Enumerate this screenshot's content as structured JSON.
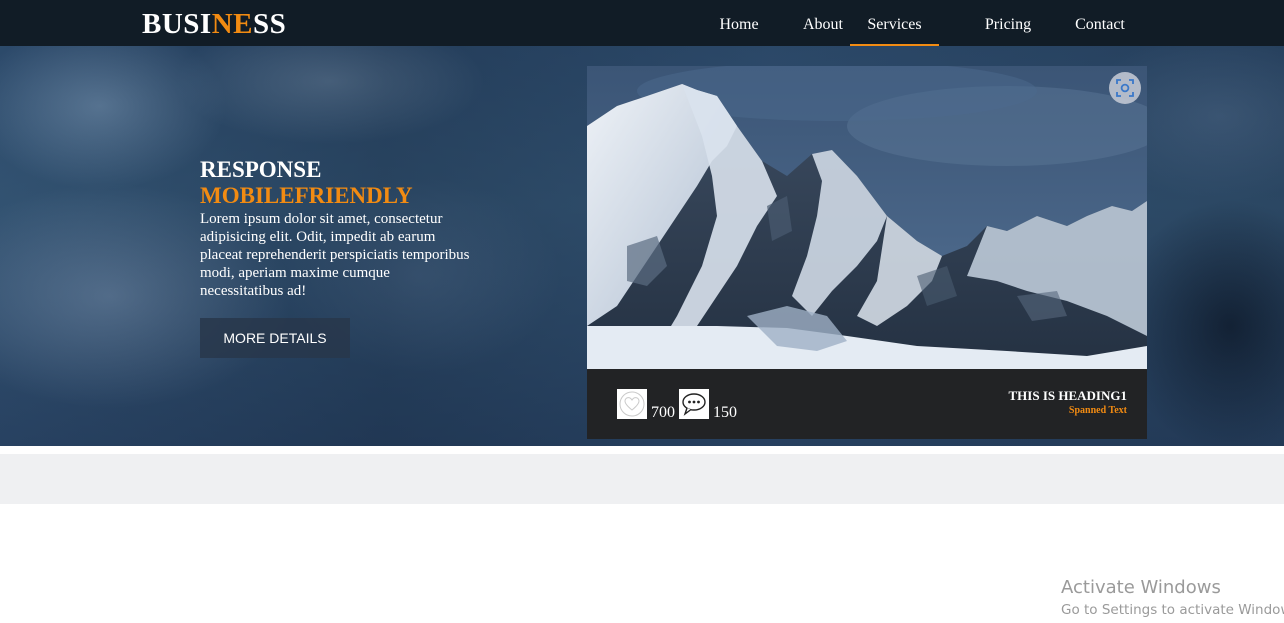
{
  "brand": {
    "prefix": "BUSI",
    "accent": "NE",
    "suffix": "SS",
    "accent_color": "#f28b12"
  },
  "nav": {
    "items": [
      {
        "label": "Home"
      },
      {
        "label": "About"
      },
      {
        "label": "Services",
        "active": true
      },
      {
        "label": "Pricing"
      },
      {
        "label": "Contact"
      }
    ]
  },
  "hero": {
    "title": "RESPONSE",
    "subtitle": "MOBILEFRIENDLY",
    "text": "Lorem ipsum dolor sit amet, consectetur adipisicing elit. Odit, impedit ab earum placeat reprehenderit perspiciatis temporibus modi, aperiam maxime cumque necessitatibus ad!",
    "button_label": "MORE DETAILS"
  },
  "card": {
    "image_icon": "mountain-photo",
    "lens_icon": "visual-search-icon",
    "likes_icon": "heart-icon",
    "likes": "700",
    "comments_icon": "speech-bubble-icon",
    "comments": "150",
    "heading": "THIS IS HEADING1",
    "span_text": "Spanned Text"
  },
  "watermark": {
    "title": "Activate Windows",
    "subtitle": "Go to Settings to activate Windows."
  },
  "colors": {
    "navbar": "#111c26",
    "accent": "#f28b12",
    "band": "#eff0f2"
  }
}
